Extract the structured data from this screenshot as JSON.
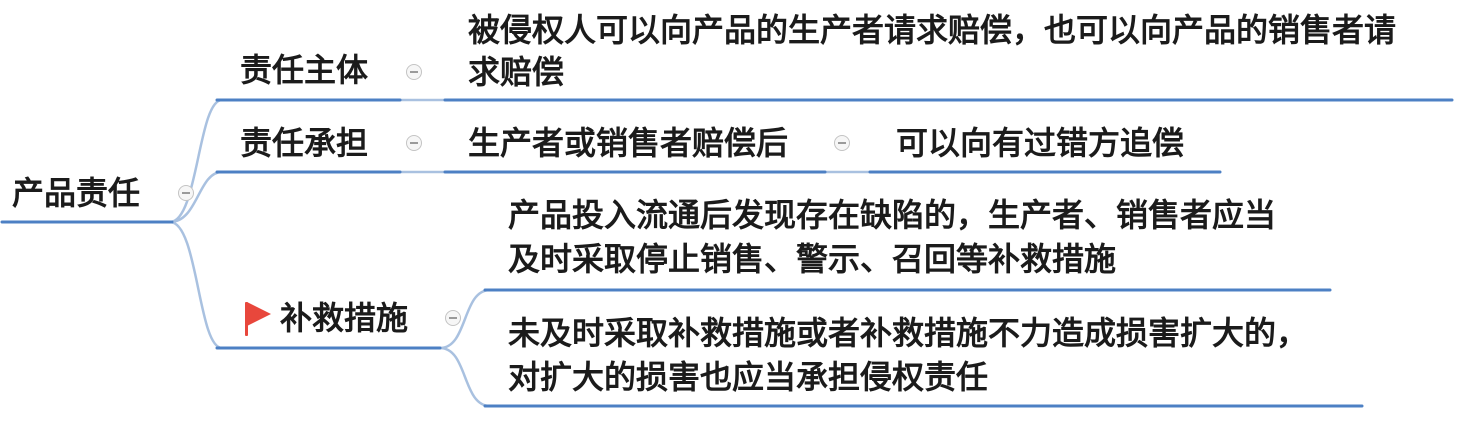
{
  "mindmap": {
    "root": {
      "label": "产品责任"
    },
    "branches": [
      {
        "label": "责任主体",
        "children": [
          {
            "lines": [
              "被侵权人可以向产品的生产者请求赔偿，也可以向产品的销售者请",
              "求赔偿"
            ]
          }
        ]
      },
      {
        "label": "责任承担",
        "children": [
          {
            "label": "生产者或销售者赔偿后",
            "children": [
              {
                "label": "可以向有过错方追偿"
              }
            ]
          }
        ]
      },
      {
        "label": "补救措施",
        "marker_icon": "red-flag-icon",
        "children": [
          {
            "lines": [
              "产品投入流通后发现存在缺陷的，生产者、销售者应当",
              "及时采取停止销售、警示、召回等补救措施"
            ]
          },
          {
            "lines": [
              "未及时采取补救措施或者补救措施不力造成损害扩大的，",
              "对扩大的损害也应当承担侵权责任"
            ]
          }
        ]
      }
    ],
    "collapse_icon": "minus-circle-icon"
  },
  "colors": {
    "line": "#4d80c4",
    "connector": "#a9c1e0",
    "flag": "#e8473c",
    "text": "#1b1b1b"
  }
}
